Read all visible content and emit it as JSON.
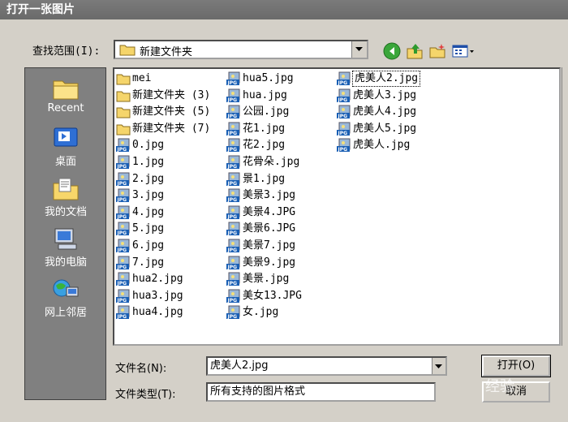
{
  "dialog": {
    "title": "打开一张图片"
  },
  "lookin": {
    "label": "查找范围(I):",
    "value": "新建文件夹"
  },
  "toolbar": {
    "back_icon": "back-arrow-icon",
    "up_icon": "up-folder-icon",
    "new_folder_icon": "new-folder-icon",
    "view_icon": "view-menu-icon"
  },
  "places": [
    {
      "label": "Recent",
      "icon": "recent-folder-icon"
    },
    {
      "label": "桌面",
      "icon": "desktop-icon"
    },
    {
      "label": "我的文档",
      "icon": "my-documents-icon"
    },
    {
      "label": "我的电脑",
      "icon": "my-computer-icon"
    },
    {
      "label": "网上邻居",
      "icon": "network-icon"
    }
  ],
  "files": {
    "col1": [
      {
        "name": "mei",
        "type": "folder"
      },
      {
        "name": "新建文件夹 (3)",
        "type": "folder"
      },
      {
        "name": "新建文件夹 (5)",
        "type": "folder"
      },
      {
        "name": "新建文件夹 (7)",
        "type": "folder"
      },
      {
        "name": "0.jpg",
        "type": "jpg"
      },
      {
        "name": "1.jpg",
        "type": "jpg"
      },
      {
        "name": "2.jpg",
        "type": "jpg"
      },
      {
        "name": "3.jpg",
        "type": "jpg"
      },
      {
        "name": "4.jpg",
        "type": "jpg"
      },
      {
        "name": "5.jpg",
        "type": "jpg"
      },
      {
        "name": "6.jpg",
        "type": "jpg"
      },
      {
        "name": "7.jpg",
        "type": "jpg"
      },
      {
        "name": "hua2.jpg",
        "type": "jpg"
      },
      {
        "name": "hua3.jpg",
        "type": "jpg"
      },
      {
        "name": "hua4.jpg",
        "type": "jpg"
      }
    ],
    "col2": [
      {
        "name": "hua5.jpg",
        "type": "jpg"
      },
      {
        "name": "hua.jpg",
        "type": "jpg"
      },
      {
        "name": "公园.jpg",
        "type": "jpg"
      },
      {
        "name": "花1.jpg",
        "type": "jpg"
      },
      {
        "name": "花2.jpg",
        "type": "jpg"
      },
      {
        "name": "花骨朵.jpg",
        "type": "jpg"
      },
      {
        "name": "景1.jpg",
        "type": "jpg"
      },
      {
        "name": "美景3.jpg",
        "type": "jpg"
      },
      {
        "name": "美景4.JPG",
        "type": "jpg"
      },
      {
        "name": "美景6.JPG",
        "type": "jpg"
      },
      {
        "name": "美景7.jpg",
        "type": "jpg"
      },
      {
        "name": "美景9.jpg",
        "type": "jpg"
      },
      {
        "name": "美景.jpg",
        "type": "jpg"
      },
      {
        "name": "美女13.JPG",
        "type": "jpg"
      },
      {
        "name": "女.jpg",
        "type": "jpg"
      }
    ],
    "col3": [
      {
        "name": "虎美人2.jpg",
        "type": "jpg",
        "selected": true
      },
      {
        "name": "虎美人3.jpg",
        "type": "jpg"
      },
      {
        "name": "虎美人4.jpg",
        "type": "jpg"
      },
      {
        "name": "虎美人5.jpg",
        "type": "jpg"
      },
      {
        "name": "虎美人.jpg",
        "type": "jpg"
      }
    ]
  },
  "filename": {
    "label": "文件名(N):",
    "value": "虎美人2.jpg"
  },
  "filetype": {
    "label": "文件类型(T):",
    "value": "所有支持的图片格式"
  },
  "buttons": {
    "open": "打开(O)",
    "cancel": "取消"
  },
  "watermark": "经验"
}
